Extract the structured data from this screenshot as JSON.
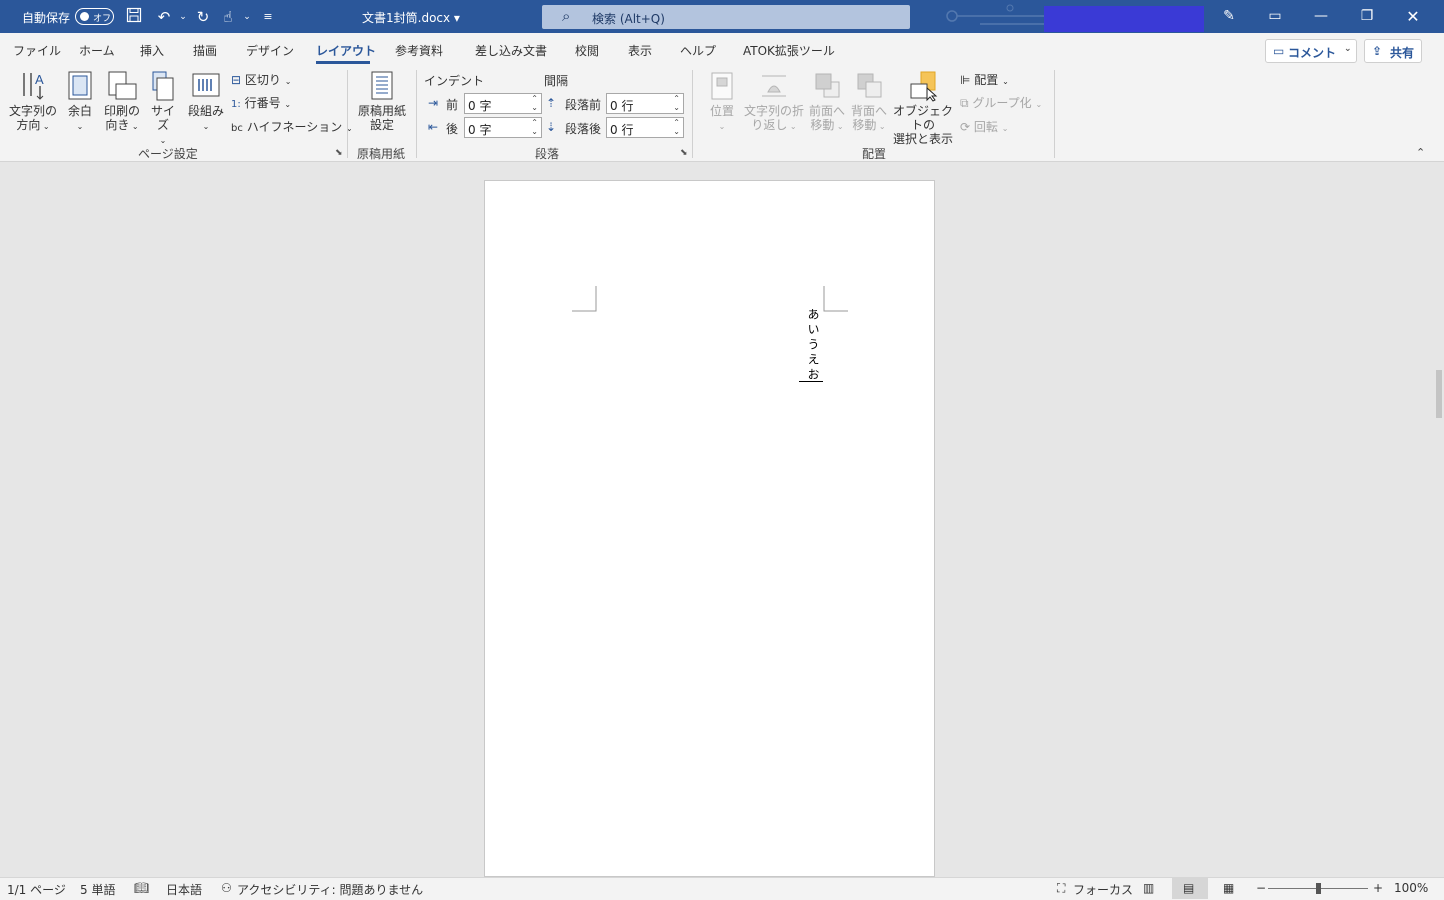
{
  "titlebar": {
    "autosave_label": "自動保存",
    "autosave_state": "オフ",
    "doc_title": "文書1封筒.docx",
    "search_placeholder": "検索 (Alt+Q)",
    "account_color": "#3a3ad6"
  },
  "tabs": [
    "ファイル",
    "ホーム",
    "挿入",
    "描画",
    "デザイン",
    "レイアウト",
    "参考資料",
    "差し込み文書",
    "校閲",
    "表示",
    "ヘルプ",
    "ATOK拡張ツール"
  ],
  "active_tab": "レイアウト",
  "comment_label": "コメント",
  "share_label": "共有",
  "ribbon": {
    "page_setup": {
      "text_direction": [
        "文字列の",
        "方向"
      ],
      "margins": "余白",
      "orientation": [
        "印刷の",
        "向き"
      ],
      "size": "サイズ",
      "columns": "段組み",
      "breaks": "区切り",
      "line_numbers": "行番号",
      "hyphenation": "ハイフネーション",
      "group_label": "ページ設定"
    },
    "genko": {
      "button": [
        "原稿用紙",
        "設定"
      ],
      "group_label": "原稿用紙"
    },
    "paragraph": {
      "indent_label": "インデント",
      "spacing_label": "間隔",
      "indent_before_label": "前",
      "indent_after_label": "後",
      "indent_before_value": "0 字",
      "indent_after_value": "0 字",
      "space_before_label": "段落前",
      "space_after_label": "段落後",
      "space_before_value": "0 行",
      "space_after_value": "0 行",
      "group_label": "段落"
    },
    "arrange": {
      "position": "位置",
      "wrap_text": [
        "文字列の折",
        "り返し"
      ],
      "bring_forward": [
        "前面へ",
        "移動"
      ],
      "send_backward": [
        "背面へ",
        "移動"
      ],
      "selection_pane": [
        "オブジェクトの",
        "選択と表示"
      ],
      "align": "配置",
      "group": "グループ化",
      "rotate": "回転",
      "group_label": "配置"
    }
  },
  "document": {
    "text": "あいうえお"
  },
  "status": {
    "page": "1/1 ページ",
    "words": "5 単語",
    "language": "日本語",
    "accessibility": "アクセシビリティ: 問題ありません",
    "focus": "フォーカス",
    "zoom": "100%",
    "zoom_level": 0.5
  }
}
